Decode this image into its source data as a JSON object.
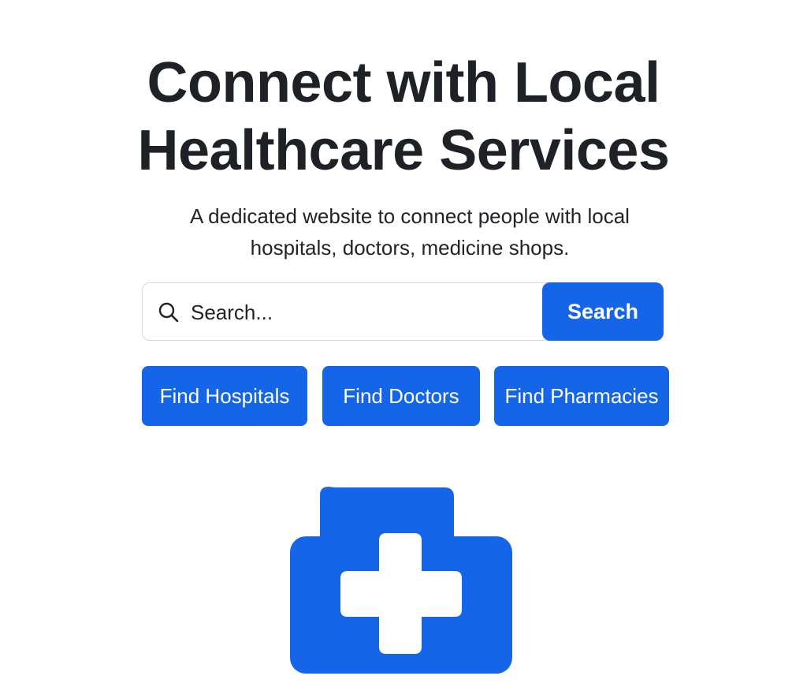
{
  "hero": {
    "title_line1": "Connect with Local",
    "title_line2": "Healthcare Services",
    "subtitle": "A dedicated website to connect people with local hospitals, doctors, medicine shops."
  },
  "search": {
    "placeholder": "Search...",
    "button_label": "Search",
    "icon": "search-icon"
  },
  "actions": [
    {
      "label": "Find Hospitals"
    },
    {
      "label": "Find Doctors"
    },
    {
      "label": "Find Pharmacies"
    }
  ],
  "illustration": {
    "icon": "medical-kit-icon"
  },
  "colors": {
    "accent": "#1565e8",
    "text": "#1f2328",
    "border": "#d3d7dc",
    "background": "#ffffff"
  }
}
